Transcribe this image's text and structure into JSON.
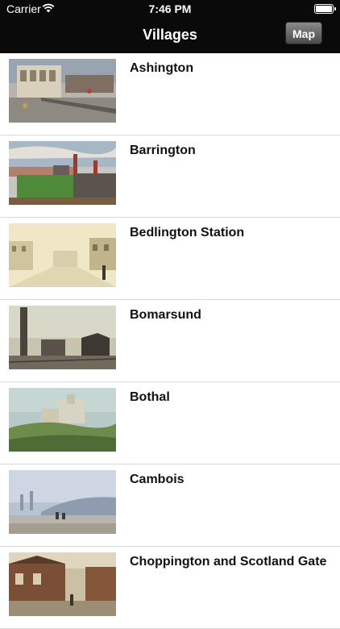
{
  "status": {
    "carrier": "Carrier",
    "time": "7:46 PM"
  },
  "nav": {
    "title": "Villages",
    "map_label": "Map"
  },
  "villages": [
    {
      "name": "Ashington",
      "image": "ashington-postcard"
    },
    {
      "name": "Barrington",
      "image": "barrington-colliery-painting"
    },
    {
      "name": "Bedlington Station",
      "image": "bedlington-station-postcard"
    },
    {
      "name": "Bomarsund",
      "image": "bomarsund-colliery-postcard"
    },
    {
      "name": "Bothal",
      "image": "bothal-castle-postcard"
    },
    {
      "name": "Cambois",
      "image": "cambois-coast-painting"
    },
    {
      "name": "Choppington and Scotland Gate",
      "image": "choppington-street-postcard"
    }
  ]
}
